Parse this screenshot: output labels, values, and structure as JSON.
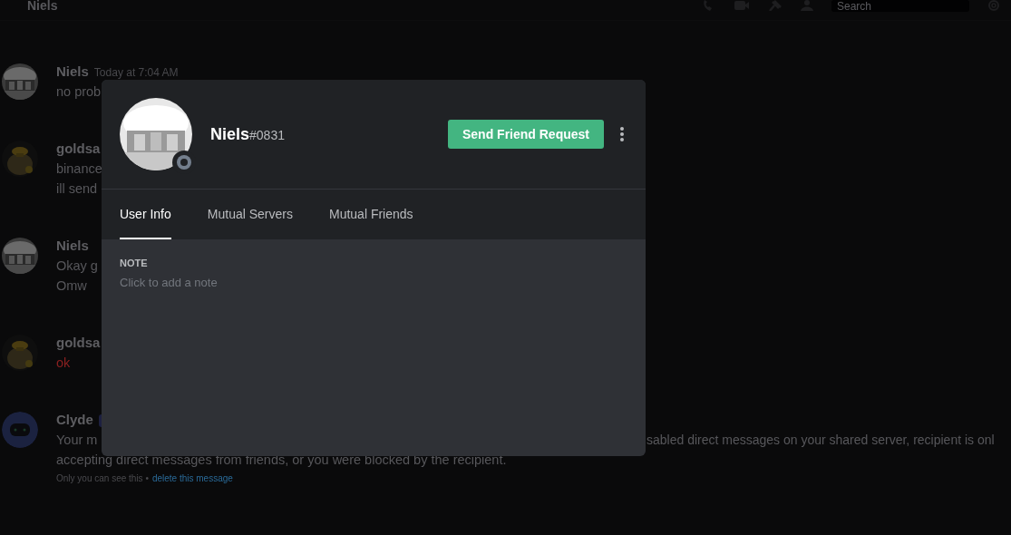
{
  "header": {
    "title": "Niels",
    "search": {
      "placeholder": "Search"
    }
  },
  "messages": [
    {
      "author": "Niels",
      "timestamp": "Today at 7:04 AM",
      "kind": "user",
      "lines": [
        {
          "text": "no prob",
          "failed": false
        }
      ]
    },
    {
      "author": "goldsa",
      "kind": "user",
      "lines": [
        {
          "text": "binance",
          "failed": false
        },
        {
          "text": "ill send",
          "failed": false
        }
      ]
    },
    {
      "author": "Niels",
      "kind": "user",
      "lines": [
        {
          "text": "Okay g",
          "failed": false
        },
        {
          "text": "Omw",
          "failed": false
        }
      ]
    },
    {
      "author": "goldsa",
      "kind": "user",
      "lines": [
        {
          "text": "ok",
          "failed": true
        }
      ]
    },
    {
      "author": "Clyde",
      "kind": "bot",
      "bot_tag": true,
      "lines": [
        {
          "text": "Your m",
          "text_right": "sabled direct messages on your shared server, recipient is onl",
          "failed": false
        },
        {
          "text": "accepting direct messages from friends, or you were blocked by the recipient.",
          "failed": false
        }
      ],
      "note": "Only you can see this •",
      "link": "delete this message"
    }
  ],
  "profile": {
    "username": "Niels",
    "discriminator": "#0831",
    "online": false,
    "button": "Send Friend Request",
    "tabs": [
      {
        "label": "User Info",
        "selected": true
      },
      {
        "label": "Mutual Servers",
        "selected": false
      },
      {
        "label": "Mutual Friends",
        "selected": false
      }
    ],
    "note": {
      "heading": "NOTE",
      "placeholder": "Click to add a note"
    }
  }
}
